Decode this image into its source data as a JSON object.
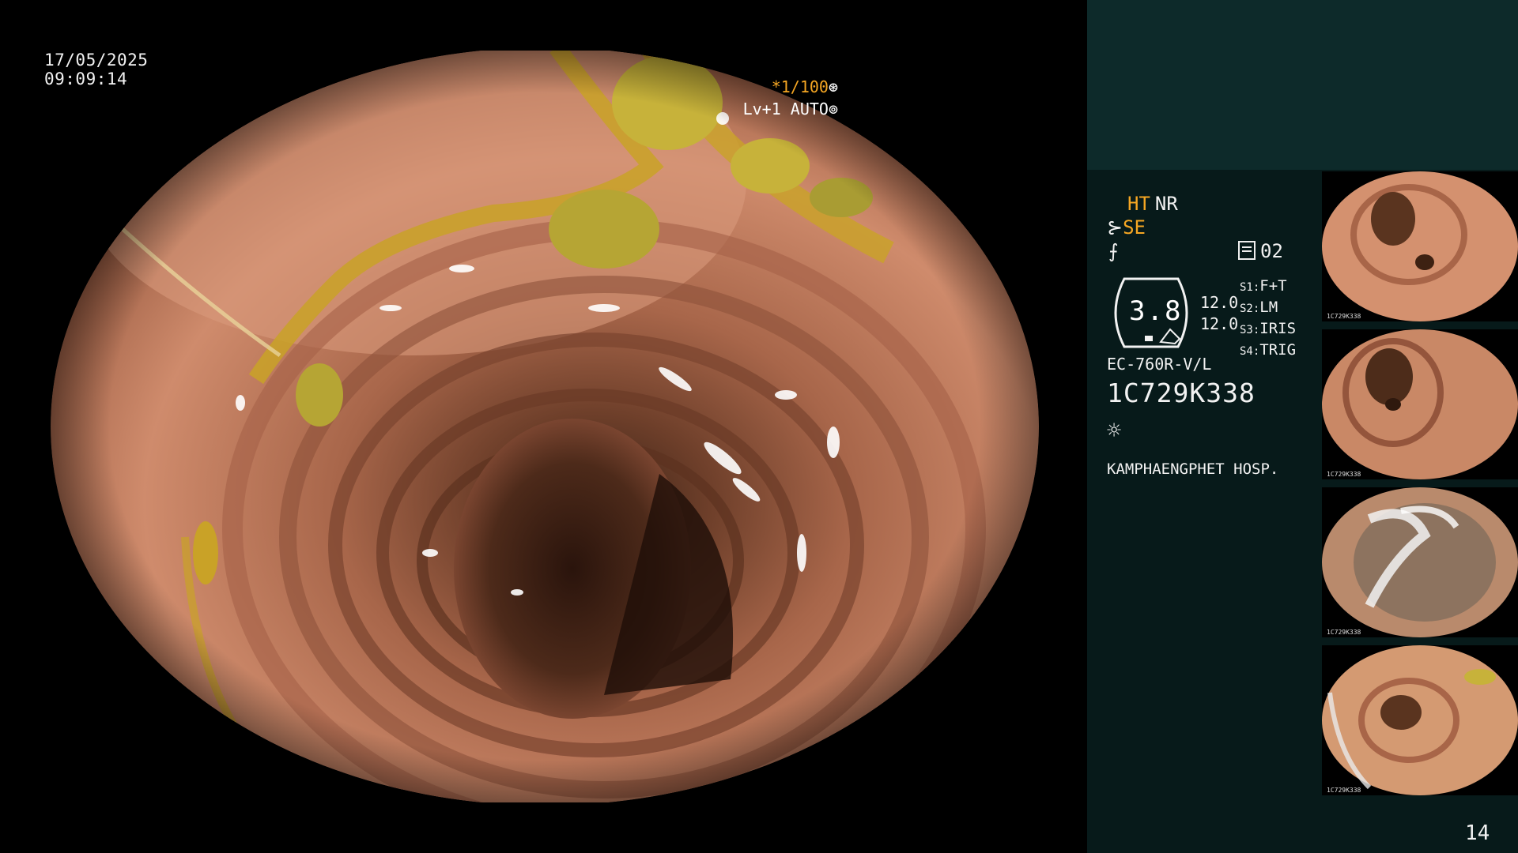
{
  "overlay": {
    "date": "17/05/2025",
    "time": "09:09:14",
    "shutter": "*1/100",
    "shutter_icon": "aperture-icon",
    "level": "Lv+1 AUTO",
    "level_icon": "iris-icon"
  },
  "info_panel": {
    "mode_ht": "HT",
    "mode_nr": "NR",
    "se_label": "SE",
    "memory_label": "02",
    "gauge_value": "3.8",
    "gauge_values": [
      "12.0",
      "12.0"
    ],
    "settings": [
      {
        "key": "S1:",
        "value": "F+T"
      },
      {
        "key": "S2:",
        "value": "LM"
      },
      {
        "key": "S3:",
        "value": "IRIS"
      },
      {
        "key": "S4:",
        "value": "TRIG"
      }
    ],
    "scope_model": "EC-760R-V/L",
    "scope_serial": "1C729K338",
    "hospital": "KAMPHAENGPHET HOSP."
  },
  "thumbnails": [
    {
      "label": "1C729K338"
    },
    {
      "label": "1C729K338"
    },
    {
      "label": "1C729K338"
    },
    {
      "label": "1C729K338"
    }
  ],
  "page_number": "14",
  "colors": {
    "panel_top": "#0d2a2a",
    "panel": "#071a1a",
    "accent": "#f5a623",
    "mucosa": "#c98866"
  }
}
